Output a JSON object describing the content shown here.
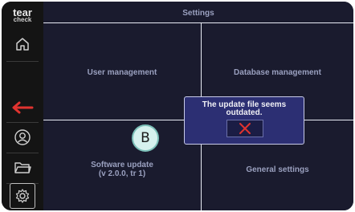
{
  "app": {
    "logo_line1": "tear",
    "logo_line2": "check"
  },
  "header": {
    "title": "Settings"
  },
  "sidebar": {
    "items": [
      {
        "icon": "home-icon"
      },
      {
        "icon": "back-arrow-icon",
        "color": "#e0332f"
      },
      {
        "icon": "user-icon"
      },
      {
        "icon": "folder-icon"
      },
      {
        "icon": "gear-icon"
      }
    ]
  },
  "menu": {
    "user_management": "User management",
    "database_management": "Database management",
    "software_update_line1": "Software update",
    "software_update_line2": "(v 2.0.0, tr 1)",
    "general_settings": "General settings"
  },
  "dialog": {
    "message_line1": "The update file seems",
    "message_line2": "outdated.",
    "close_icon": "close-icon",
    "close_color": "#e0332f"
  },
  "badge": {
    "label": "B"
  },
  "colors": {
    "background": "#1a1b2e",
    "sidebar": "#141414",
    "dialog": "#2c2f73",
    "accent_red": "#e0332f",
    "badge": "#d6f1ee"
  }
}
